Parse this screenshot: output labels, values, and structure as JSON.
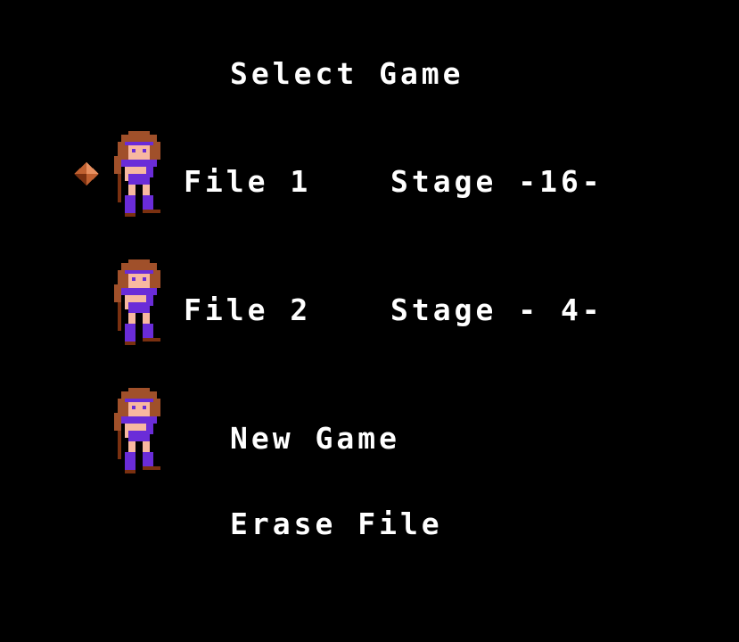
{
  "screen": {
    "title": "Select Game"
  },
  "files": [
    {
      "label": "File 1",
      "stage": "Stage -16-"
    },
    {
      "label": "File 2",
      "stage": "Stage - 4-"
    }
  ],
  "menu": {
    "new_game": "New Game",
    "erase_file": "Erase File"
  },
  "selected_index": 0,
  "colors": {
    "background": "#000000",
    "text": "#ffffff",
    "hair": "#a0502a",
    "skin": "#f8b8a0",
    "outfit": "#6a2cd8",
    "boots": "#7a3010",
    "cursor": "#c06030"
  }
}
